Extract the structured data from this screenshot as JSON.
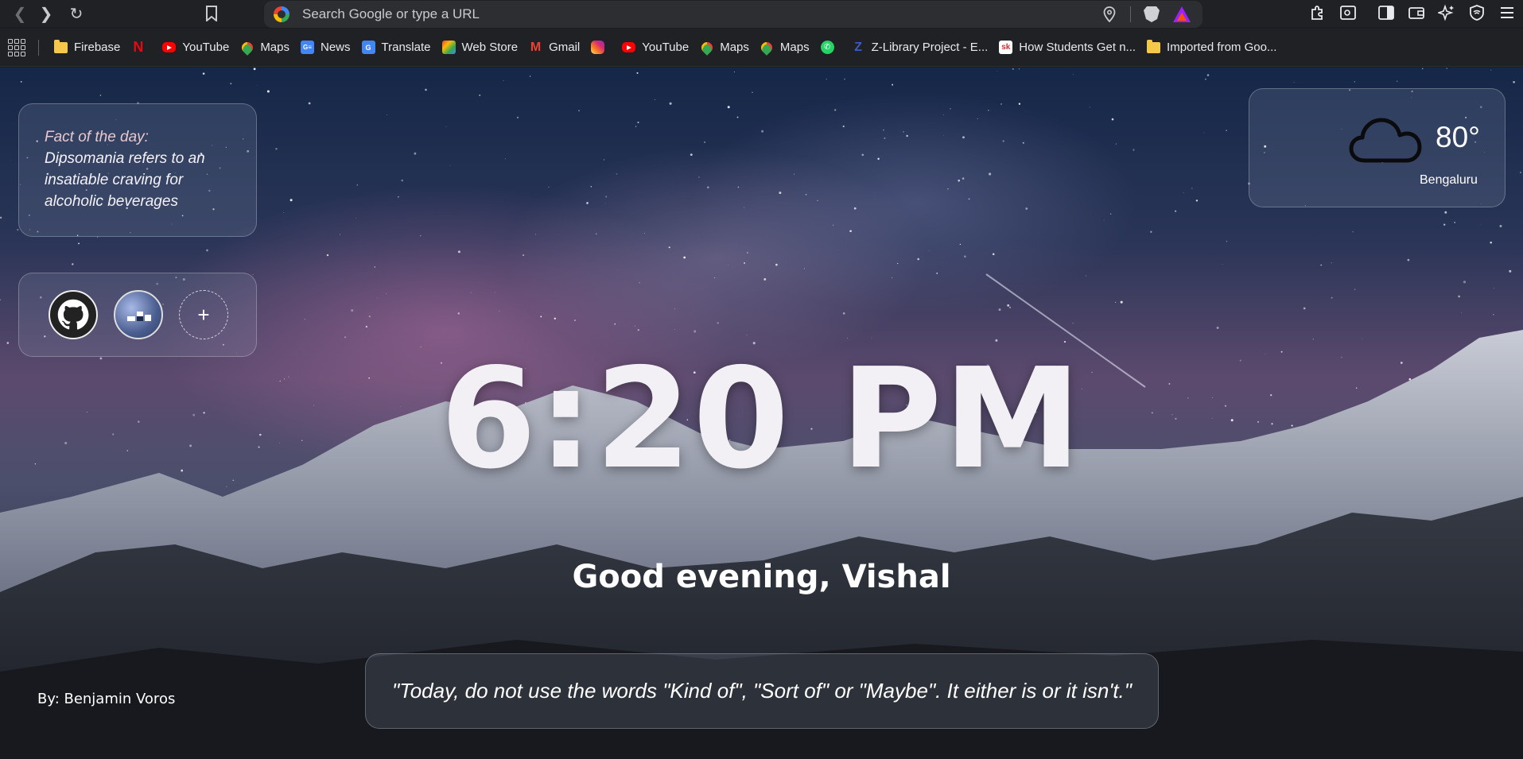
{
  "toolbar": {
    "omnibox_placeholder": "Search Google or type a URL"
  },
  "bookmarks": [
    {
      "label": "Firebase",
      "icon": "folder-icon"
    },
    {
      "label": "",
      "icon": "netflix-icon"
    },
    {
      "label": "YouTube",
      "icon": "youtube-icon"
    },
    {
      "label": "Maps",
      "icon": "maps-icon"
    },
    {
      "label": "News",
      "icon": "google-news-icon"
    },
    {
      "label": "Translate",
      "icon": "google-translate-icon"
    },
    {
      "label": "Web Store",
      "icon": "web-store-icon"
    },
    {
      "label": "Gmail",
      "icon": "gmail-icon"
    },
    {
      "label": "",
      "icon": "instagram-icon"
    },
    {
      "label": "YouTube",
      "icon": "youtube-icon"
    },
    {
      "label": "Maps",
      "icon": "maps-icon"
    },
    {
      "label": "Maps",
      "icon": "maps-icon"
    },
    {
      "label": "",
      "icon": "whatsapp-icon"
    },
    {
      "label": "Z-Library Project - E...",
      "icon": "zlibrary-icon"
    },
    {
      "label": "How Students Get n...",
      "icon": "sk-icon"
    },
    {
      "label": "Imported from Goo...",
      "icon": "folder-icon"
    }
  ],
  "fact": {
    "label": "Fact of the day:",
    "text": "Dipsomania refers to an insatiable craving for alcoholic beverages"
  },
  "shortcuts": [
    {
      "name": "github-shortcut",
      "icon": "github-icon"
    },
    {
      "name": "app-shortcut",
      "icon": "app-icon"
    },
    {
      "name": "add-shortcut",
      "icon": "plus-icon",
      "symbol": "+"
    }
  ],
  "weather": {
    "temperature": "80°",
    "city": "Bengaluru",
    "icon": "cloud-icon"
  },
  "clock": {
    "time": "6:20 PM"
  },
  "greeting": "Good evening, Vishal",
  "quote": {
    "text": "\"Today, do not use the words \"Kind of\", \"Sort of\" or \"Maybe\". It either is or it isn't.\""
  },
  "credit": "By: Benjamin Voros"
}
